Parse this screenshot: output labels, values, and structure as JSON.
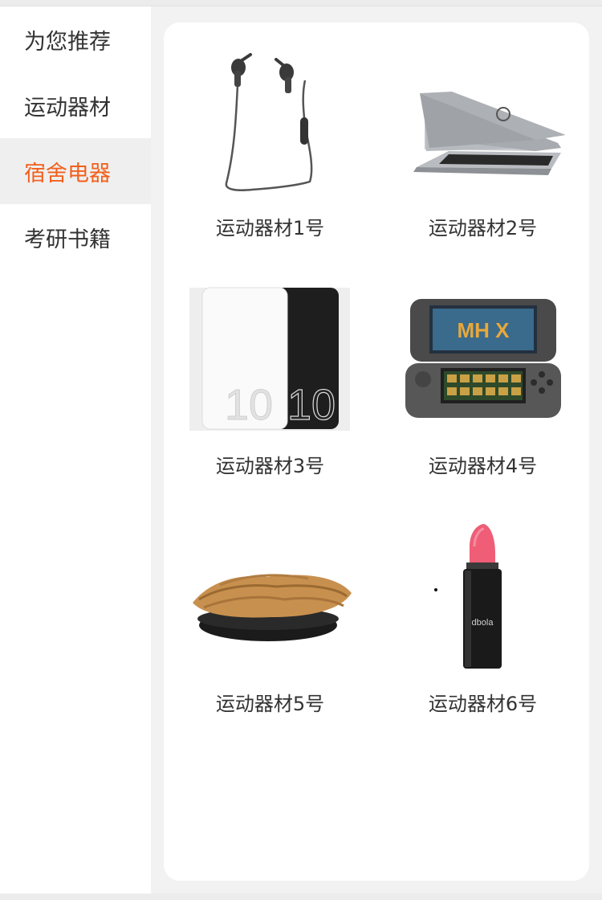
{
  "sidebar": {
    "items": [
      {
        "label": "为您推荐",
        "active": false
      },
      {
        "label": "运动器材",
        "active": false
      },
      {
        "label": "宿舍电器",
        "active": true
      },
      {
        "label": "考研书籍",
        "active": false
      }
    ],
    "active_color": "#f2601d"
  },
  "products": [
    {
      "label": "运动器材1号",
      "icon": "earphones-image"
    },
    {
      "label": "运动器材2号",
      "icon": "laptop-image"
    },
    {
      "label": "运动器材3号",
      "icon": "power-bank-image"
    },
    {
      "label": "运动器材4号",
      "icon": "handheld-console-image"
    },
    {
      "label": "运动器材5号",
      "icon": "crackers-bowl-image"
    },
    {
      "label": "运动器材6号",
      "icon": "lipstick-image"
    }
  ]
}
